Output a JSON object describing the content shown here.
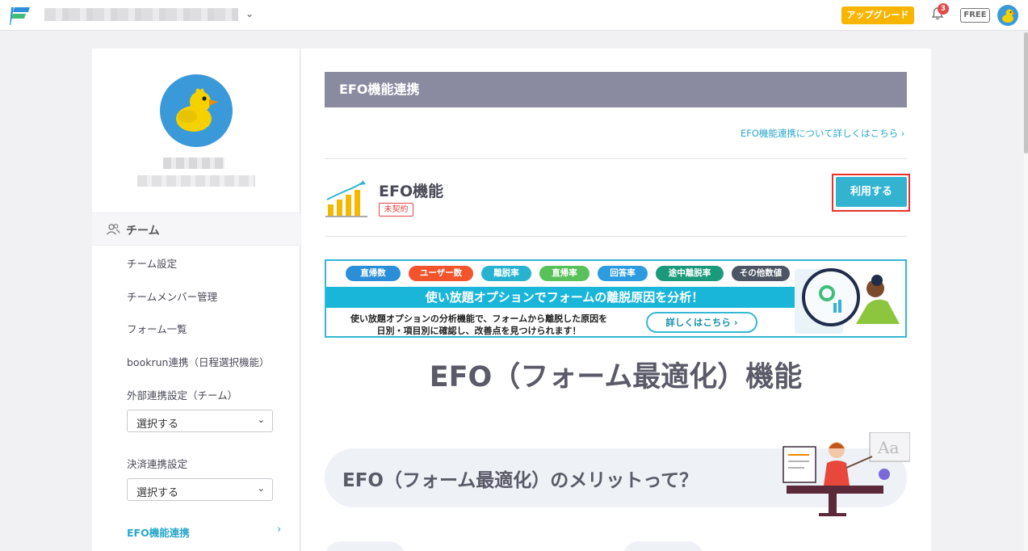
{
  "header": {
    "workspace_name": "",
    "upgrade_label": "アップグレード",
    "notification_count": "3",
    "plan_label": "FREE"
  },
  "sidebar": {
    "team_label": "チーム",
    "links": [
      "チーム設定",
      "チームメンバー管理",
      "フォーム一覧",
      "bookrun連携（日程選択機能）",
      "外部連携設定（チーム）",
      "決済連携設定"
    ],
    "select_external": "選択する",
    "select_payment": "選択する",
    "active_item": "EFO機能連携"
  },
  "main": {
    "section_title": "EFO機能連携",
    "learn_more": "EFO機能連携について詳しくはこちら",
    "feature_title": "EFO機能",
    "status_badge": "未契約",
    "use_button": "利用する",
    "banner": {
      "tags": [
        "直帰数",
        "ユーザー数",
        "離脱率",
        "直帰率",
        "回答率",
        "途中離脱率",
        "その他数値"
      ],
      "tag_colors": [
        "#2a8fd6",
        "#f2552c",
        "#27b3d0",
        "#59c15a",
        "#2c9be0",
        "#1a9a7a",
        "#4b5563"
      ],
      "headline": "使い放題オプションでフォームの離脱原因を分析！",
      "sub_line1": "使い放題オプションの分析機能で、フォームから離脱した原因を",
      "sub_line2": "日別・項目別に確認し、改善点を見つけられます！",
      "button": "詳しくはこちら"
    },
    "big_title": "EFO（フォーム最適化）機能",
    "merit_title": "EFO（フォーム最適化）のメリットって？"
  },
  "colors": {
    "accent": "#34b3d1",
    "header_bar": "#8a8ba0",
    "upgrade": "#f7b500",
    "alert": "#e04848"
  }
}
